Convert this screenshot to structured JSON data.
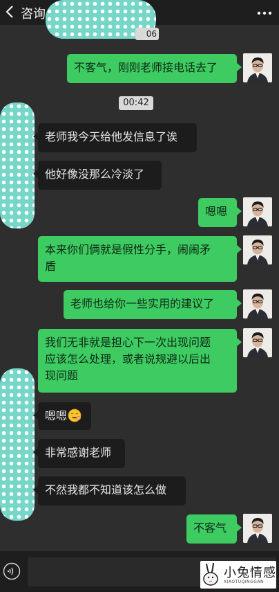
{
  "header": {
    "title": "咨询"
  },
  "timestamps": {
    "top_partial": "06",
    "mid": "00:42"
  },
  "messages": [
    {
      "side": "right",
      "text": "不客气，刚刚老师接电话去了"
    },
    {
      "side": "left",
      "text": "老师我今天给他发信息了诶"
    },
    {
      "side": "left",
      "text": "他好像没那么冷淡了"
    },
    {
      "side": "right",
      "text": "嗯嗯"
    },
    {
      "side": "right",
      "lines": [
        "本来你们俩就是假性分手，闹闹矛",
        "盾"
      ]
    },
    {
      "side": "right",
      "text": "老师也给你一些实用的建议了"
    },
    {
      "side": "right",
      "lines": [
        "我们无非就是担心下一次出现问题",
        "应该怎么处理，或者说规避以后出",
        "现问题"
      ]
    },
    {
      "side": "left",
      "text": "嗯嗯"
    },
    {
      "side": "left",
      "text": "非常感谢老师"
    },
    {
      "side": "left",
      "text": "不然我都不知道该怎么做"
    },
    {
      "side": "right",
      "text": "不客气"
    }
  ],
  "watermark": {
    "text": "小兔情感",
    "sub": "XIAOTUQINGGAN"
  },
  "icons": {
    "back": "back-arrow-icon",
    "more": "more-dots-icon",
    "voice": "voice-input-icon",
    "emoji": "emoji-face-icon"
  },
  "colors": {
    "sent_bubble": "#3ecb62",
    "received_bubble": "#1c1c1c",
    "background": "#2e2e2e"
  }
}
